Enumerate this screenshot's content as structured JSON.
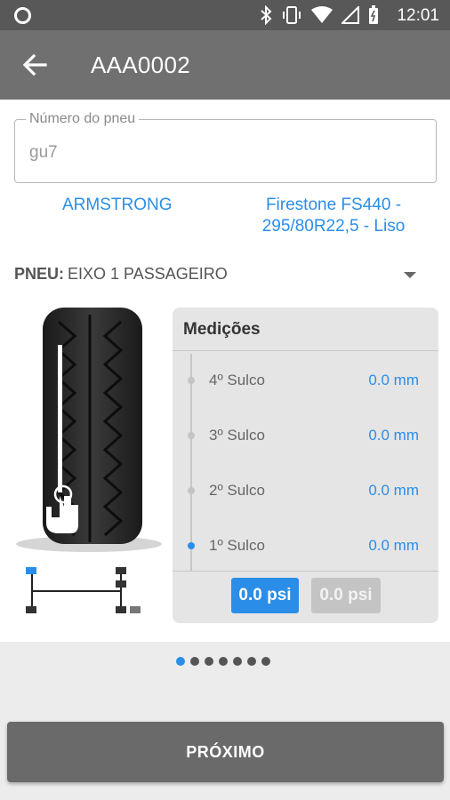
{
  "status_bar": {
    "time": "12:01",
    "icons": [
      "circle-icon",
      "bluetooth-icon",
      "vibrate-icon",
      "wifi-icon",
      "signal-icon",
      "battery-icon"
    ]
  },
  "app_bar": {
    "title": "AAA0002",
    "back_icon": "arrow-back-icon"
  },
  "tire_number": {
    "label": "Número do pneu",
    "value": "gu7"
  },
  "tire_info": {
    "brand": "ARMSTRONG",
    "model": "Firestone FS440 - 295/80R22,5 - Liso"
  },
  "tire_select": {
    "key": "PNEU:",
    "value": "EIXO 1 PASSAGEIRO"
  },
  "measurements": {
    "title": "Medições",
    "rows": [
      {
        "name": "4º Sulco",
        "value": "0.0 mm",
        "active": false
      },
      {
        "name": "3º Sulco",
        "value": "0.0 mm",
        "active": false
      },
      {
        "name": "2º Sulco",
        "value": "0.0 mm",
        "active": false
      },
      {
        "name": "1º Sulco",
        "value": "0.0 mm",
        "active": true
      }
    ],
    "psi_primary": "0.0 psi",
    "psi_secondary": "0.0 psi"
  },
  "pager": {
    "count": 7,
    "active_index": 0
  },
  "actions": {
    "next_label": "PRÓXIMO"
  },
  "colors": {
    "accent": "#2a8ee8",
    "app_bar": "#707070",
    "status_bar": "#585858"
  }
}
